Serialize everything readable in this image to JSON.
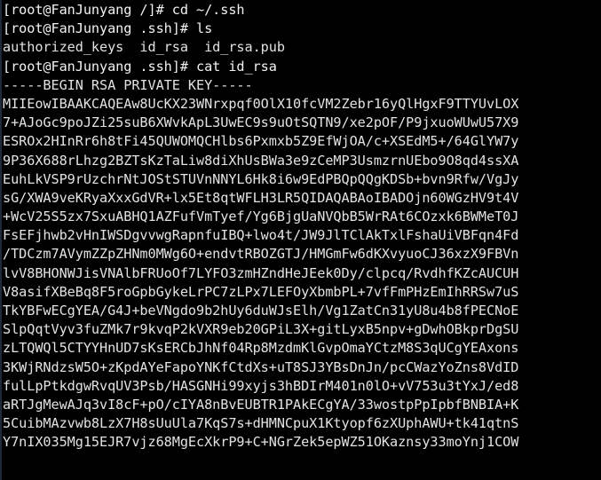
{
  "window": {
    "title": "root@FanJunyang:~/.ssh",
    "background_color": "#000000",
    "foreground_color": "#e6e6e6",
    "columns": 72,
    "rows": 26
  },
  "terminal": {
    "shell_user": "root",
    "hostname": "FanJunyang",
    "commands": [
      {
        "prompt": "[root@FanJunyang /]#",
        "command": "cd ~/.ssh"
      },
      {
        "prompt": "[root@FanJunyang .ssh]#",
        "command": "ls"
      },
      {
        "prompt": "[root@FanJunyang .ssh]#",
        "command": "cat id_rsa"
      }
    ],
    "ls_output": [
      "authorized_keys",
      "id_rsa",
      "id_rsa.pub"
    ],
    "lines": [
      "[root@FanJunyang /]# cd ~/.ssh",
      "[root@FanJunyang .ssh]# ls",
      "authorized_keys  id_rsa  id_rsa.pub",
      "[root@FanJunyang .ssh]# cat id_rsa",
      "-----BEGIN RSA PRIVATE KEY-----",
      "MIIEowIBAAKCAQEAw8UcKX23WNrxpqf0OlX10fcVM2Zebr16yQlHgxF9TTYUvLOX",
      "7+AJoGc9poJZi25suB6XWvkApL3UwEC9s9uOtSQTN9/xe2pOF/P9jxuoWUwU57X9",
      "ESROx2HInRr6h8tFi45QUWOMQCHlbs6Pxmxb5Z9EfWjOA/c+XSEdM5+/64GlYW7y",
      "9P36X688rLhzg2BZTsKzTaLiw8diXhUsBWa3e9zCeMP3UsmzrnUEbo9O8qd4ssXA",
      "EuhLkVSP9rUzchrNtJOStSTUVnNNYL6Hk8i6w9EdPBQpQQgKDSb+bvn9Rfw/VgJy",
      "sG/XWA9veKRyaXxxGdVR+lx5Et8qtWFLH3LR5QIDAQABAoIBADOjn60WGzHV9t4V",
      "+WcV25S5zx7SxuABHQ1AZFufVmTyef/Yg6BjgUaNVQbB5WrRAt6COzxk6BWMeT0J",
      "FsEFjhwb2vHnIWSDgvvwgRapnfuIBQ+lwo4t/JW9JlTClAkTxlFshaUiVBFqn4Fd",
      "/TDCzm7AVymZZpZHNm0MWg6O+endvtRBOZGTJ/HMGmFw6dKXvyuoCJ36xzX9FBVn",
      "lvV8BHONWJisVNAlbFRUoOf7LYFO3zmHZndHeJEek0Dy/clpcq/RvdhfKZcAUCUH",
      "V8asifXBeBq8F5roGpbGykeLrPC7zLPx7LEFOyXbmbPL+7vfFmPHzEmIhRRSw7uS",
      "TkYBFwECgYEA/G4J+beVNgdo9b2hUy6duWJsElh/Vg1ZatCn31yU8u4b8fPECNoE",
      "SlpQqtVyv3fuZMk7r9kvqP2kVXR9eb20GPiL3X+gitLyxB5npv+gDwhOBkprDgSU",
      "zLTQWQl5CTYYHnUD7sKsERCbJhNf04Rp8MzdmKlGvpOmaYCtzM8S3qUCgYEAxons",
      "3KWjRNdzsW5O+zKpdAYeFapoYNKfCtdXs+uT8SJ3YBsDnJn/pcCWazYoZns8VdID",
      "fulLpPtkdgwRvqUV3Psb/HASGNHi99xyjs3hBDIrM401n0lO+vV753u3tYxJ/ed8",
      "aRTJgMewAJq3vI8cF+pO/cIYA8nBvEUBTR1PAkECgYA/33wostpPpIpbfBNBIA+K",
      "5CuibMAzvwb8LzX7H8sUuUla7KqS7s+dHMNCpuX1Ktyopf6zXUphAWU+tk41qtnS",
      "Y7nIX035Mg15EJR7vjz68MgEcXkrP9+C+NGrZek5epWZ51OKaznsy33moYnj1COW"
    ]
  }
}
